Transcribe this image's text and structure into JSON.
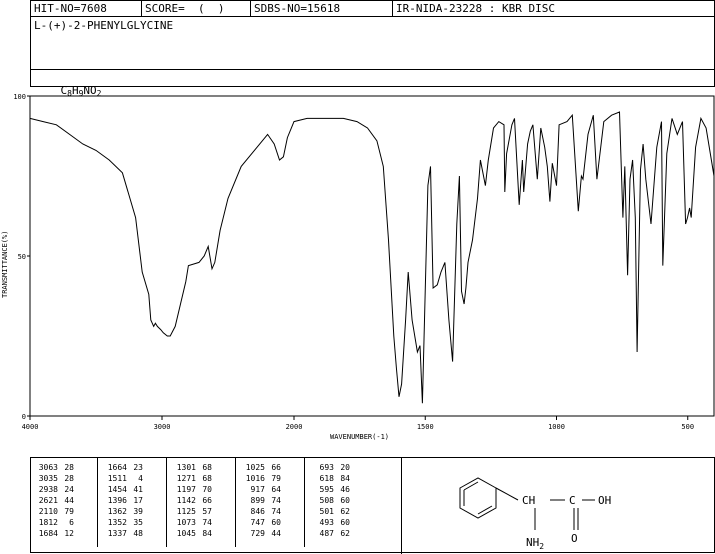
{
  "header": {
    "hit_no": "HIT-NO=7608",
    "score": "SCORE=  (  )",
    "sdbs_no": "SDBS-NO=15618",
    "ir": "IR-NIDA-23228 : KBR DISC"
  },
  "compound_name": "L-(+)-2-PHENYLGLYCINE",
  "formula": {
    "parts": [
      "C",
      "8",
      "H",
      "9",
      "NO",
      "2"
    ]
  },
  "chart_data": {
    "type": "line",
    "xlabel": "WAVENUMBER(-1)",
    "ylabel": "TRANSMITTANCE(%)",
    "xlim": [
      4000,
      400
    ],
    "ylim": [
      0,
      100
    ],
    "x_ticks": [
      "4000",
      "3000",
      "2000",
      "1500",
      "1000",
      "500"
    ],
    "y_ticks": [
      "100",
      "50",
      "0"
    ],
    "grid": false,
    "series": [
      {
        "x": [
          4000,
          3900,
          3800,
          3700,
          3600,
          3500,
          3400,
          3300,
          3200,
          3150,
          3100,
          3085,
          3063,
          3050,
          3035,
          3010,
          2990,
          2960,
          2938,
          2900,
          2860,
          2820,
          2800,
          2720,
          2680,
          2650,
          2621,
          2600,
          2560,
          2500,
          2400,
          2300,
          2200,
          2150,
          2110,
          2080,
          2050,
          2000,
          1950,
          1900,
          1850,
          1812,
          1760,
          1720,
          1684,
          1660,
          1640,
          1620,
          1610,
          1600,
          1590,
          1575,
          1565,
          1550,
          1530,
          1520,
          1511,
          1500,
          1490,
          1480,
          1470,
          1454,
          1440,
          1425,
          1410,
          1396,
          1380,
          1370,
          1362,
          1352,
          1345,
          1337,
          1320,
          1301,
          1290,
          1271,
          1260,
          1240,
          1220,
          1200,
          1197,
          1190,
          1170,
          1160,
          1142,
          1130,
          1125,
          1110,
          1100,
          1090,
          1073,
          1060,
          1045,
          1035,
          1025,
          1016,
          1000,
          990,
          960,
          940,
          917,
          905,
          899,
          880,
          860,
          846,
          820,
          790,
          760,
          747,
          740,
          729,
          720,
          710,
          700,
          693,
          680,
          670,
          660,
          640,
          618,
          600,
          595,
          580,
          560,
          540,
          520,
          508,
          501,
          493,
          487,
          470,
          450,
          430,
          400
        ],
        "y": [
          93,
          92,
          91,
          88,
          85,
          83,
          80,
          76,
          62,
          45,
          38,
          30,
          28,
          29,
          28,
          27,
          26,
          25,
          25,
          28,
          35,
          42,
          47,
          48,
          50,
          53,
          46,
          48,
          58,
          68,
          78,
          83,
          88,
          85,
          80,
          81,
          87,
          92,
          93,
          93,
          93,
          93,
          92,
          90,
          86,
          78,
          55,
          25,
          15,
          6,
          10,
          30,
          45,
          30,
          20,
          22,
          4,
          40,
          72,
          78,
          40,
          41,
          45,
          48,
          30,
          17,
          60,
          75,
          39,
          35,
          40,
          48,
          55,
          68,
          80,
          72,
          80,
          90,
          92,
          91,
          70,
          82,
          91,
          93,
          66,
          80,
          70,
          85,
          89,
          91,
          74,
          90,
          84,
          78,
          67,
          79,
          72,
          91,
          92,
          94,
          64,
          75,
          74,
          88,
          94,
          74,
          92,
          94,
          95,
          62,
          78,
          44,
          74,
          80,
          62,
          20,
          77,
          85,
          74,
          60,
          84,
          92,
          47,
          82,
          93,
          88,
          92,
          60,
          62,
          65,
          62,
          84,
          93,
          90,
          75
        ]
      }
    ]
  },
  "peak_table": [
    [
      [
        "3063",
        "28"
      ],
      [
        "3035",
        "28"
      ],
      [
        "2938",
        "24"
      ],
      [
        "2621",
        "44"
      ],
      [
        "2110",
        "79"
      ],
      [
        "1812",
        "6"
      ],
      [
        "1684",
        "12"
      ]
    ],
    [
      [
        "1664",
        "23"
      ],
      [
        "1511",
        "4"
      ],
      [
        "1454",
        "41"
      ],
      [
        "1396",
        "17"
      ],
      [
        "1362",
        "39"
      ],
      [
        "1352",
        "35"
      ],
      [
        "1337",
        "48"
      ]
    ],
    [
      [
        "1301",
        "68"
      ],
      [
        "1271",
        "68"
      ],
      [
        "1197",
        "70"
      ],
      [
        "1142",
        "66"
      ],
      [
        "1125",
        "57"
      ],
      [
        "1073",
        "74"
      ],
      [
        "1045",
        "84"
      ]
    ],
    [
      [
        "1025",
        "66"
      ],
      [
        "1016",
        "79"
      ],
      [
        "917",
        "64"
      ],
      [
        "899",
        "74"
      ],
      [
        "846",
        "74"
      ],
      [
        "747",
        "60"
      ],
      [
        "729",
        "44"
      ]
    ],
    [
      [
        "693",
        "20"
      ],
      [
        "618",
        "84"
      ],
      [
        "595",
        "46"
      ],
      [
        "508",
        "60"
      ],
      [
        "501",
        "62"
      ],
      [
        "493",
        "60"
      ],
      [
        "487",
        "62"
      ]
    ]
  ],
  "structure": {
    "ch": "CH",
    "c": "C",
    "oh": "OH",
    "o": "O",
    "nh": "NH",
    "nh_sub": "2"
  }
}
